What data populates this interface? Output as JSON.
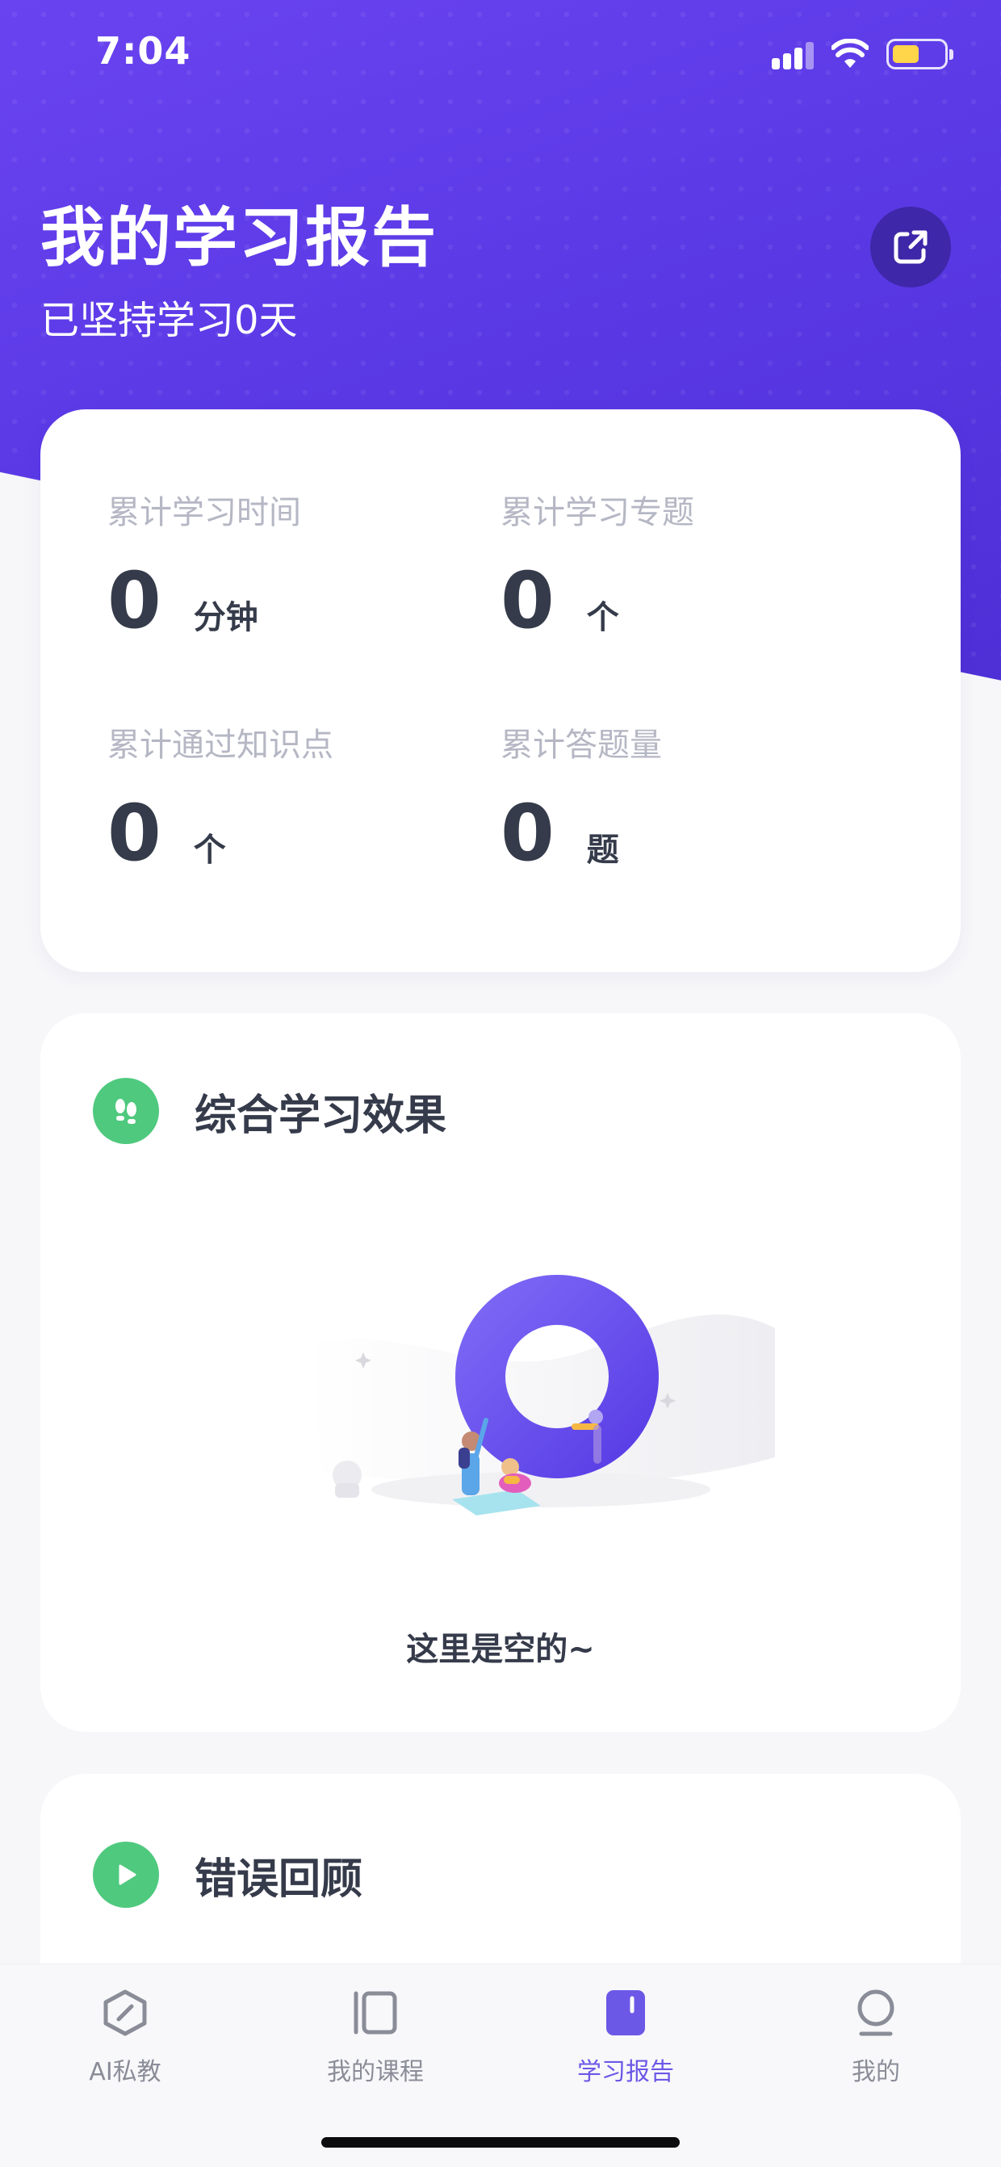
{
  "status_bar": {
    "time": "7:04"
  },
  "header": {
    "title": "我的学习报告",
    "subtitle": "已坚持学习0天",
    "share_icon": "share-icon"
  },
  "stats": [
    {
      "label": "累计学习时间",
      "value": "0",
      "unit": "分钟"
    },
    {
      "label": "累计学习专题",
      "value": "0",
      "unit": "个"
    },
    {
      "label": "累计通过知识点",
      "value": "0",
      "unit": "个"
    },
    {
      "label": "累计答题量",
      "value": "0",
      "unit": "题"
    }
  ],
  "effect_section": {
    "title": "综合学习效果",
    "icon": "footprints-icon",
    "empty_text": "这里是空的~"
  },
  "review_section": {
    "title": "错误回顾",
    "icon": "play-icon"
  },
  "tabs": [
    {
      "label": "AI私教",
      "icon": "ai-tutor-icon",
      "active": false
    },
    {
      "label": "我的课程",
      "icon": "courses-icon",
      "active": false
    },
    {
      "label": "学习报告",
      "icon": "report-icon",
      "active": true
    },
    {
      "label": "我的",
      "icon": "profile-icon",
      "active": false
    }
  ],
  "colors": {
    "header_gradient_start": "#6a43f0",
    "header_gradient_end": "#4e2fd6",
    "accent_green": "#4fc97e",
    "active_tab": "#6b58e6",
    "inactive_tab": "#8a8d98"
  }
}
